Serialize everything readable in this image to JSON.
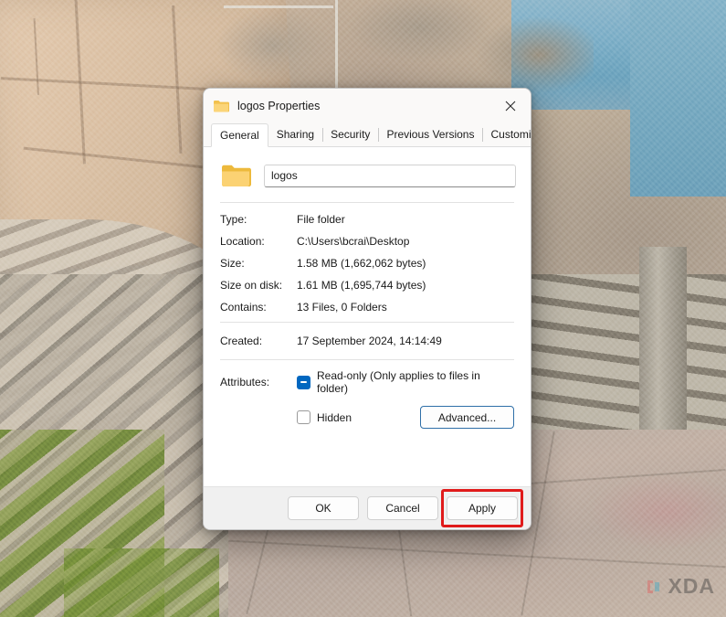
{
  "wallpaper": {
    "description": "open-air stone amphitheatre by the sea"
  },
  "watermark": {
    "text": "XDA"
  },
  "dialog": {
    "titlebar": {
      "icon": "folder-icon",
      "title": "logos Properties",
      "close_icon": "close-icon"
    },
    "tabs": [
      {
        "label": "General",
        "active": true
      },
      {
        "label": "Sharing",
        "active": false
      },
      {
        "label": "Security",
        "active": false
      },
      {
        "label": "Previous Versions",
        "active": false
      },
      {
        "label": "Customise",
        "active": false
      }
    ],
    "general": {
      "folder_icon": "folder-icon",
      "name_value": "logos",
      "name_placeholder": "",
      "info": [
        {
          "label": "Type:",
          "value": "File folder"
        },
        {
          "label": "Location:",
          "value": "C:\\Users\\bcrai\\Desktop"
        },
        {
          "label": "Size:",
          "value": "1.58 MB (1,662,062 bytes)"
        },
        {
          "label": "Size on disk:",
          "value": "1.61 MB (1,695,744 bytes)"
        },
        {
          "label": "Contains:",
          "value": "13 Files, 0 Folders"
        }
      ],
      "created": {
        "label": "Created:",
        "value": "17 September 2024, 14:14:49"
      },
      "attributes": {
        "label": "Attributes:",
        "readonly_label": "Read-only (Only applies to files in folder)",
        "readonly_state": "indeterminate",
        "hidden_label": "Hidden",
        "hidden_state": "unchecked",
        "advanced_label": "Advanced..."
      }
    },
    "footer": {
      "ok_label": "OK",
      "cancel_label": "Cancel",
      "apply_label": "Apply"
    },
    "annotation": {
      "highlight_color": "#e01b1b",
      "highlight_target": "Apply"
    }
  }
}
